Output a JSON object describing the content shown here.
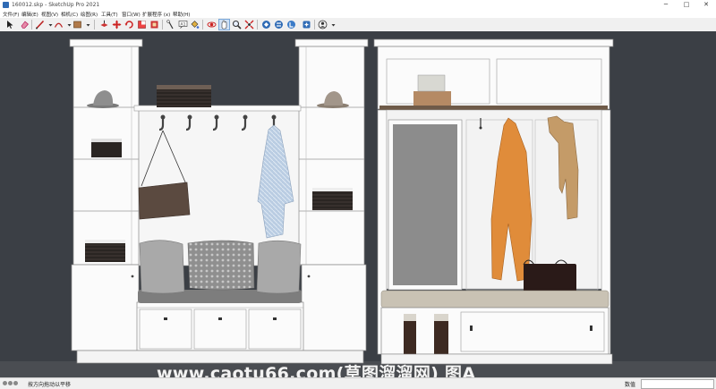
{
  "window": {
    "title": "160012.skp - SketchUp Pro 2021",
    "controls": [
      "─",
      "□",
      "✕"
    ]
  },
  "menu": [
    "文件(F)",
    "编辑(E)",
    "视图(V)",
    "相机(C)",
    "绘图(R)",
    "工具(T)",
    "窗口(W)",
    "扩展程序 (x)",
    "帮助(H)"
  ],
  "toolbar": {
    "tools": [
      "select-tool",
      "eraser-tool",
      "line-tool",
      "arc-tool",
      "shapes-tool",
      "push-pull-tool",
      "move-tool",
      "rotate-tool",
      "scale-tool",
      "offset-tool",
      "tape-measure-tool",
      "text-tool",
      "paint-bucket-tool",
      "orbit-tool",
      "pan-tool",
      "zoom-tool",
      "zoom-extents-tool",
      "3d-warehouse-tool",
      "extension-warehouse-tool",
      "layout-tool",
      "extension-manager-tool",
      "account-tool"
    ]
  },
  "status": {
    "hint": "按方向拖动以平移",
    "value_label": "数值",
    "value": ""
  },
  "watermark": "www.caotu66.com(草图溜溜网) 图A",
  "colors": {
    "viewport_bg": "#3b3f45",
    "cabinet_white": "#fbfbfb",
    "toolbar_bg": "#f0f0f0"
  }
}
